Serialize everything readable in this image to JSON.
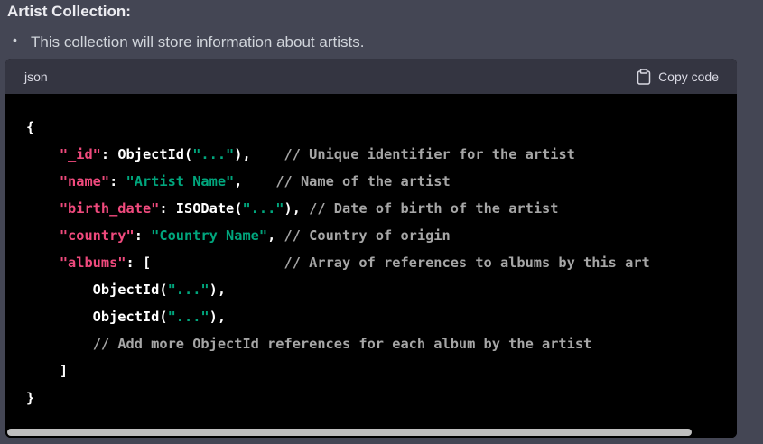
{
  "heading": "Artist Collection:",
  "bullet": {
    "marker": "•",
    "text": "This collection will store information about artists."
  },
  "code_block": {
    "language": "json",
    "copy_label": "Copy code",
    "copy_icon": "clipboard-icon",
    "lines": [
      [
        {
          "t": "plain",
          "v": "{"
        }
      ],
      [
        {
          "t": "plain",
          "v": "    "
        },
        {
          "t": "key",
          "v": "\"_id\""
        },
        {
          "t": "plain",
          "v": ": ObjectId("
        },
        {
          "t": "str",
          "v": "\"...\""
        },
        {
          "t": "plain",
          "v": "),    "
        },
        {
          "t": "comment",
          "v": "// Unique identifier for the artist"
        }
      ],
      [
        {
          "t": "plain",
          "v": "    "
        },
        {
          "t": "key",
          "v": "\"name\""
        },
        {
          "t": "plain",
          "v": ": "
        },
        {
          "t": "str",
          "v": "\"Artist Name\""
        },
        {
          "t": "plain",
          "v": ",    "
        },
        {
          "t": "comment",
          "v": "// Name of the artist"
        }
      ],
      [
        {
          "t": "plain",
          "v": "    "
        },
        {
          "t": "key",
          "v": "\"birth_date\""
        },
        {
          "t": "plain",
          "v": ": ISODate("
        },
        {
          "t": "str",
          "v": "\"...\""
        },
        {
          "t": "plain",
          "v": "), "
        },
        {
          "t": "comment",
          "v": "// Date of birth of the artist"
        }
      ],
      [
        {
          "t": "plain",
          "v": "    "
        },
        {
          "t": "key",
          "v": "\"country\""
        },
        {
          "t": "plain",
          "v": ": "
        },
        {
          "t": "str",
          "v": "\"Country Name\""
        },
        {
          "t": "plain",
          "v": ", "
        },
        {
          "t": "comment",
          "v": "// Country of origin"
        }
      ],
      [
        {
          "t": "plain",
          "v": "    "
        },
        {
          "t": "key",
          "v": "\"albums\""
        },
        {
          "t": "plain",
          "v": ": [                "
        },
        {
          "t": "comment",
          "v": "// Array of references to albums by this art"
        }
      ],
      [
        {
          "t": "plain",
          "v": "        ObjectId("
        },
        {
          "t": "str",
          "v": "\"...\""
        },
        {
          "t": "plain",
          "v": "),"
        }
      ],
      [
        {
          "t": "plain",
          "v": "        ObjectId("
        },
        {
          "t": "str",
          "v": "\"...\""
        },
        {
          "t": "plain",
          "v": "),"
        }
      ],
      [
        {
          "t": "plain",
          "v": "        "
        },
        {
          "t": "comment",
          "v": "// Add more ObjectId references for each album by the artist"
        }
      ],
      [
        {
          "t": "plain",
          "v": "    ]"
        }
      ],
      [
        {
          "t": "plain",
          "v": "}"
        }
      ]
    ]
  },
  "colors": {
    "page_bg": "#444654",
    "header_bg": "#343541",
    "code_bg": "#000000",
    "key": "#ef4a7d",
    "string": "#00a67d",
    "comment": "#a6a6a6"
  },
  "scrollbar": {
    "horizontal_visible_fraction": 0.94
  }
}
